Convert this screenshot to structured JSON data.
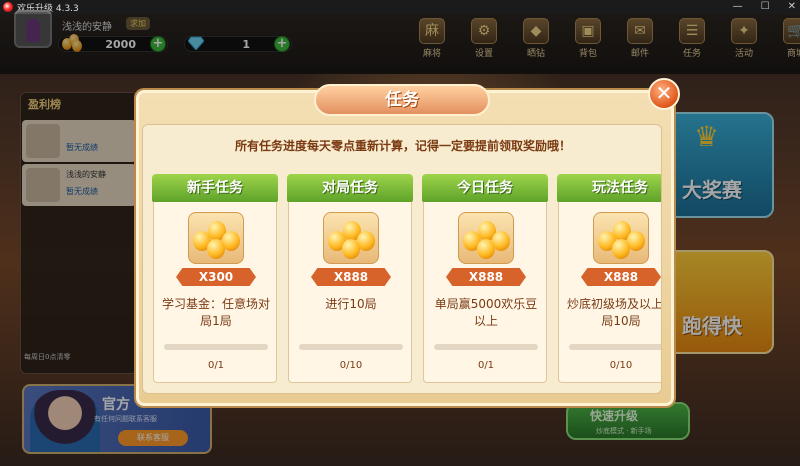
{
  "window": {
    "title": "欢乐升级 4.3.3",
    "min": "—",
    "max": "☐",
    "close": "✕"
  },
  "player": {
    "name": "浅浅的安静",
    "vip": "求加",
    "coins": "2000",
    "gems": "1",
    "plus": "+"
  },
  "topnav": [
    {
      "icon": "麻",
      "label": "麻将"
    },
    {
      "icon": "⚙",
      "label": "设置"
    },
    {
      "icon": "◆",
      "label": "晒钻"
    },
    {
      "icon": "▣",
      "label": "背包"
    },
    {
      "icon": "✉",
      "label": "邮件"
    },
    {
      "icon": "☰",
      "label": "任务"
    },
    {
      "icon": "✦",
      "label": "活动"
    },
    {
      "icon": "🛒",
      "label": "商城"
    }
  ],
  "leftpanel": {
    "title": "盈利榜",
    "rows": [
      {
        "name": "",
        "sub": "暂无成绩"
      },
      {
        "name": "浅浅的安静",
        "sub": "暂无成绩"
      }
    ],
    "note": "每周日0点清零"
  },
  "ad": {
    "title": "官方",
    "sub": "有任何问题联系客服",
    "button": "联系客服"
  },
  "right": {
    "card1": "大奖赛",
    "card2": "跑得快",
    "quick_title": "快速升级",
    "quick_sub": "炒底模式 · 新手场"
  },
  "modal": {
    "title": "任务",
    "close": "✕",
    "notice": "所有任务进度每天零点重新计算，记得一定要提前领取奖励哦！",
    "tasks": [
      {
        "header": "新手任务",
        "reward": "X300",
        "desc": "学习基金：任意场对局1局",
        "progress": "0/1",
        "fraction": 0
      },
      {
        "header": "对局任务",
        "reward": "X888",
        "desc": "进行10局",
        "progress": "0/10",
        "fraction": 0
      },
      {
        "header": "今日任务",
        "reward": "X888",
        "desc": "单局赢5000欢乐豆以上",
        "progress": "0/1",
        "fraction": 0
      },
      {
        "header": "玩法任务",
        "reward": "X888",
        "desc": "炒底初级场及以上对局10局",
        "progress": "0/10",
        "fraction": 0
      }
    ]
  },
  "colors": {
    "task_header": "#7cc23a",
    "reward_ribbon": "#d7632a",
    "accent_text": "#7a3a12"
  }
}
